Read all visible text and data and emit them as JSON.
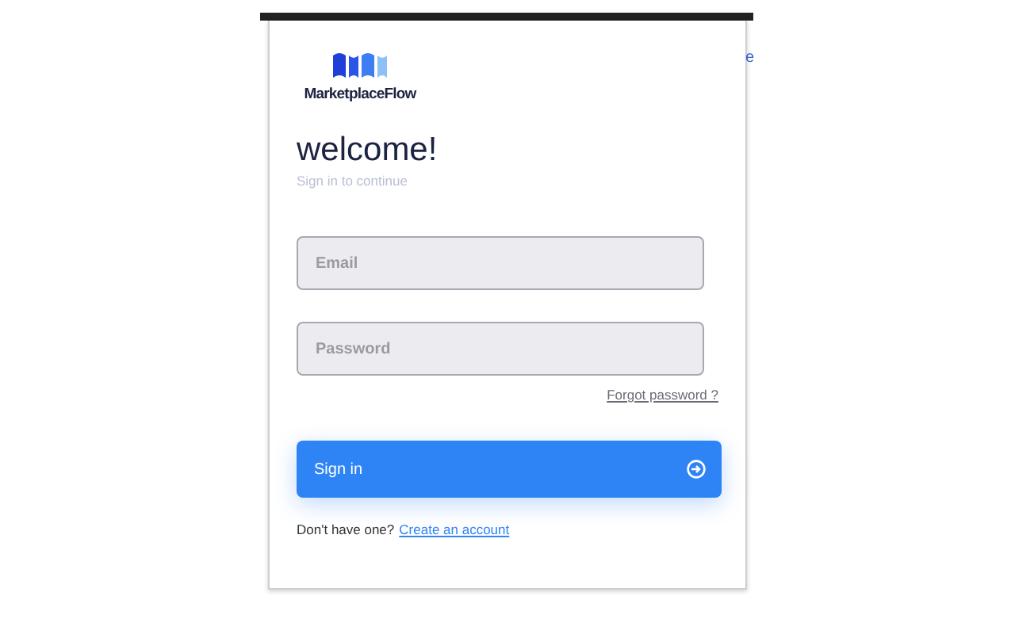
{
  "backdrop": {
    "text": "e"
  },
  "dialog": {
    "brand": "MarketplaceFlow",
    "heading": "welcome!",
    "subheading": "Sign in to continue",
    "fields": [
      {
        "placeholder": "Email"
      },
      {
        "placeholder": "Password"
      }
    ],
    "forgot_link": "Forgot password ?",
    "submit_button": "Sign in",
    "footer": {
      "text": "Don't have one?",
      "link": "Create an account"
    }
  }
}
